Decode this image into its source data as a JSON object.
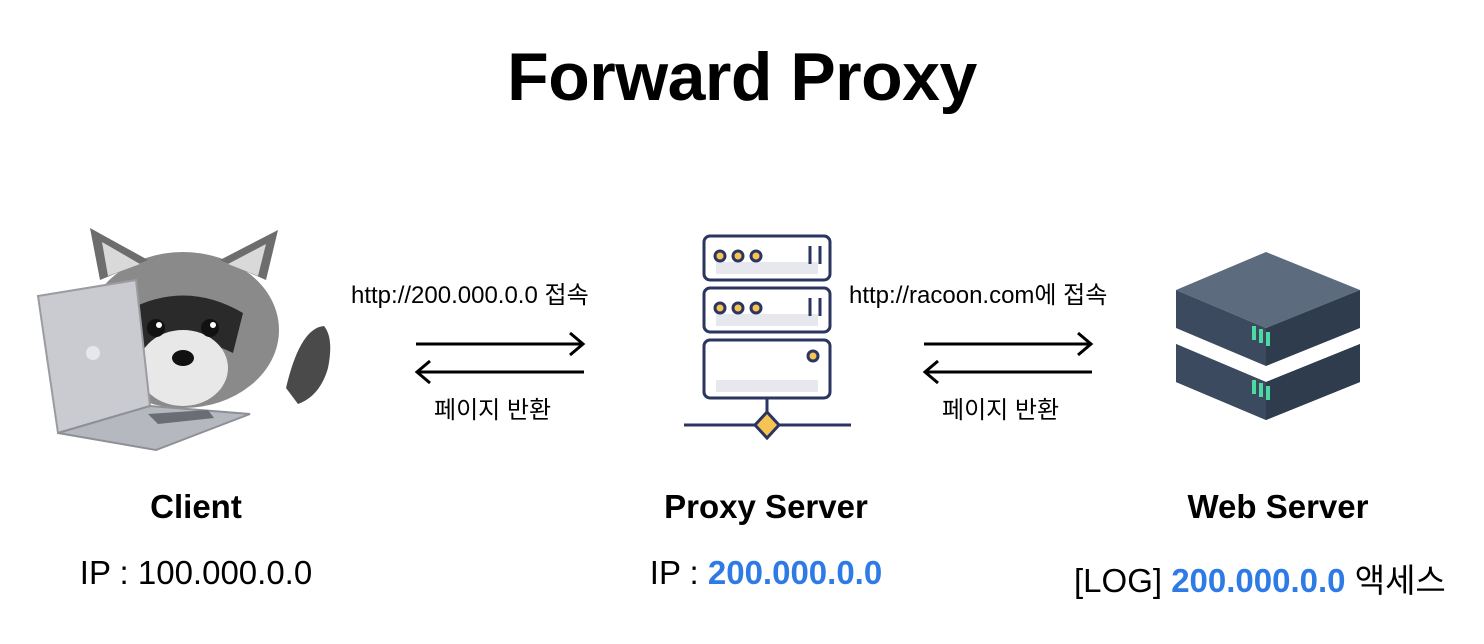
{
  "title": "Forward Proxy",
  "colors": {
    "highlight": "#2f7be6",
    "proxy_outline": "#2b3561",
    "proxy_accent": "#f6c453",
    "server_dark": "#3b4a5e",
    "server_light": "#5d6b7e",
    "server_led": "#4dd9a2"
  },
  "icons": {
    "client": "raccoon-laptop-icon",
    "proxy": "proxy-server-rack-icon",
    "web": "web-server-stack-icon"
  },
  "edges": {
    "client_to_proxy_request": "http://200.000.0.0 접속",
    "proxy_to_client_response": "페이지 반환",
    "proxy_to_web_request": "http://racoon.com에 접속",
    "web_to_proxy_response": "페이지 반환"
  },
  "nodes": {
    "client": {
      "name": "Client",
      "info_prefix": "IP : ",
      "info_value": "100.000.0.0"
    },
    "proxy": {
      "name": "Proxy Server",
      "info_prefix": "IP : ",
      "info_value": "200.000.0.0"
    },
    "web": {
      "name": "Web Server",
      "info_prefix": "[LOG] ",
      "info_value": "200.000.0.0",
      "info_suffix": " 액세스"
    }
  }
}
